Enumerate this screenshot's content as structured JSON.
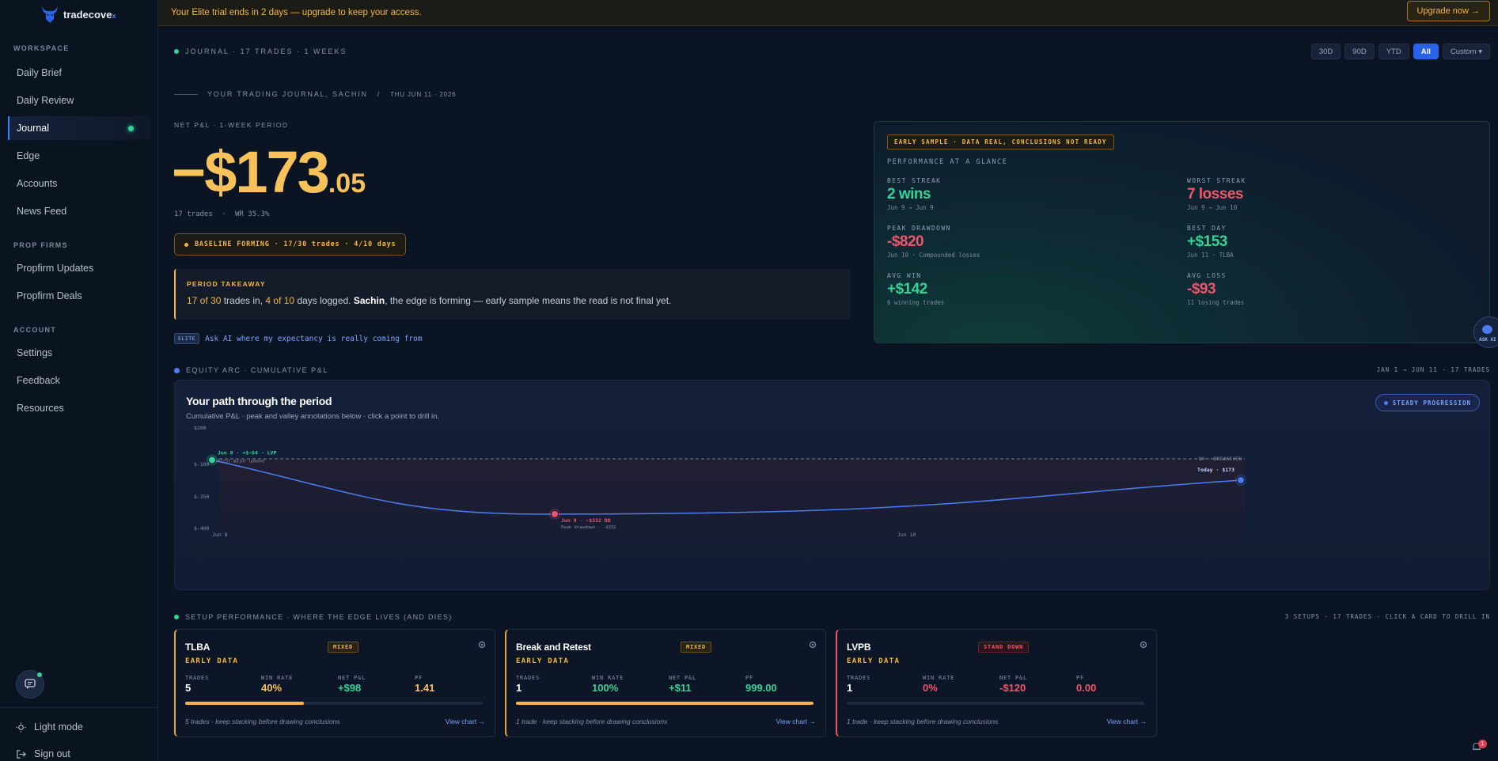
{
  "brand": {
    "name": "tradecove",
    "suffix": "x"
  },
  "sidebar": {
    "sections": [
      "WORKSPACE",
      "PROP FIRMS",
      "ACCOUNT"
    ],
    "workspace": [
      "Daily Brief",
      "Daily Review",
      "Journal",
      "Edge",
      "Accounts",
      "News Feed"
    ],
    "propfirms": [
      "Propfirm Updates",
      "Propfirm Deals"
    ],
    "account": [
      "Settings",
      "Feedback",
      "Resources"
    ],
    "active": "Journal",
    "bottom": {
      "light_mode": "Light mode",
      "sign_out": "Sign out"
    }
  },
  "banner": {
    "text": "Your Elite trial ends in 2 days — upgrade to keep your access.",
    "cta": "Upgrade now →"
  },
  "header": {
    "journal_label": "JOURNAL · 17 TRADES · 1 WEEKS",
    "ranges": [
      "30D",
      "90D",
      "YTD",
      "All",
      "Custom ▾"
    ],
    "active_range": "All",
    "title_line": "YOUR TRADING JOURNAL, SACHIN",
    "date_line": "THU JUN 11 · 2026"
  },
  "pnl": {
    "label": "NET P&L · 1-WEEK PERIOD",
    "main": "−$173",
    "cents": ".05",
    "trades": "17 trades",
    "wr": "WR 35.3%",
    "baseline": "BASELINE FORMING · 17/30 trades · 4/10 days"
  },
  "takeaway": {
    "label": "PERIOD TAKEAWAY",
    "trades_part": "17 of 30",
    "trades_rest": " trades in, ",
    "days_part": "4 of 10",
    "days_rest": " days logged. ",
    "name": "Sachin",
    "tail": ", the edge is forming — early sample means the read is not final yet."
  },
  "ask_ai": {
    "tag": "ELITE",
    "text": "Ask AI where my expectancy is really coming from"
  },
  "glance": {
    "tag": "EARLY SAMPLE · DATA REAL, CONCLUSIONS NOT READY",
    "title": "PERFORMANCE AT A GLANCE",
    "best_streak": {
      "label": "BEST STREAK",
      "value": "2 wins",
      "sub": "Jun 9 → Jun 9"
    },
    "worst_streak": {
      "label": "WORST STREAK",
      "value": "7 losses",
      "sub": "Jun 9 → Jun 10"
    },
    "peak_drawdown": {
      "label": "PEAK DRAWDOWN",
      "value": "-$820",
      "sub": "Jun 10 · Compounded losses"
    },
    "best_day": {
      "label": "BEST DAY",
      "value": "+$153",
      "sub": "Jun 11 · TLBA"
    },
    "avg_win": {
      "label": "AVG WIN",
      "value": "+$142",
      "sub": "6 winning trades"
    },
    "avg_loss": {
      "label": "AVG LOSS",
      "value": "-$93",
      "sub": "11 losing trades"
    }
  },
  "side_ask": {
    "label": "ASK AI"
  },
  "equity": {
    "section": "EQUITY ARC · CUMULATIVE P&L",
    "range": "JAN 1 → JUN 11 · 17 TRADES",
    "title": "Your path through the period",
    "subtitle": "Cumulative P&L · peak and valley annotations below · click a point to drill in.",
    "badge": "STEADY PROGRESSION",
    "baseline_label": "$0 · BREAKEVEN"
  },
  "chart_data": {
    "type": "line",
    "y_ticks": [
      "$200",
      "$-100",
      "$-250",
      "$-400"
    ],
    "x_ticks": [
      "Jun 8",
      "Jun 10"
    ],
    "points": [
      {
        "x": "Jun 8",
        "y": -64,
        "label": "Jun 8 · +$-64 · LVP",
        "note": "First major upmove"
      },
      {
        "x": "Jun 9",
        "y": -332,
        "label": "Jun 9 · -$332 DD",
        "note": "Peak drawdown · -$332"
      },
      {
        "x": "Today",
        "y": -173,
        "label": "Today · $173"
      }
    ],
    "colors": {
      "line": "#4d7cf2",
      "peak": "#34d399",
      "valley": "#f2546b"
    }
  },
  "setups": {
    "section": "SETUP PERFORMANCE · WHERE THE EDGE LIVES (AND DIES)",
    "meta": "3 SETUPS · 17 TRADES · CLICK A CARD TO DRILL IN",
    "metric_labels": [
      "TRADES",
      "WIN RATE",
      "NET P&L",
      "PF"
    ],
    "cards": [
      {
        "name": "TLBA",
        "badge": "MIXED",
        "stage": "EARLY DATA",
        "trades": "5",
        "win_rate": "40%",
        "net": "+$98",
        "pf": "1.41",
        "progress": 0.4,
        "note": "5 trades · keep stacking before drawing conclusions",
        "link": "View chart →"
      },
      {
        "name": "Break and Retest",
        "badge": "MIXED",
        "stage": "EARLY DATA",
        "trades": "1",
        "win_rate": "100%",
        "net": "+$11",
        "pf": "999.00",
        "progress": 1.0,
        "note": "1 trade · keep stacking before drawing conclusions",
        "link": "View chart →"
      },
      {
        "name": "LVPB",
        "badge": "STAND DOWN",
        "stage": "EARLY DATA",
        "trades": "1",
        "win_rate": "0%",
        "net": "-$120",
        "pf": "0.00",
        "progress": 0.0,
        "note": "1 trade · keep stacking before drawing conclusions",
        "link": "View chart →"
      }
    ]
  },
  "notifications": {
    "count": "1"
  }
}
